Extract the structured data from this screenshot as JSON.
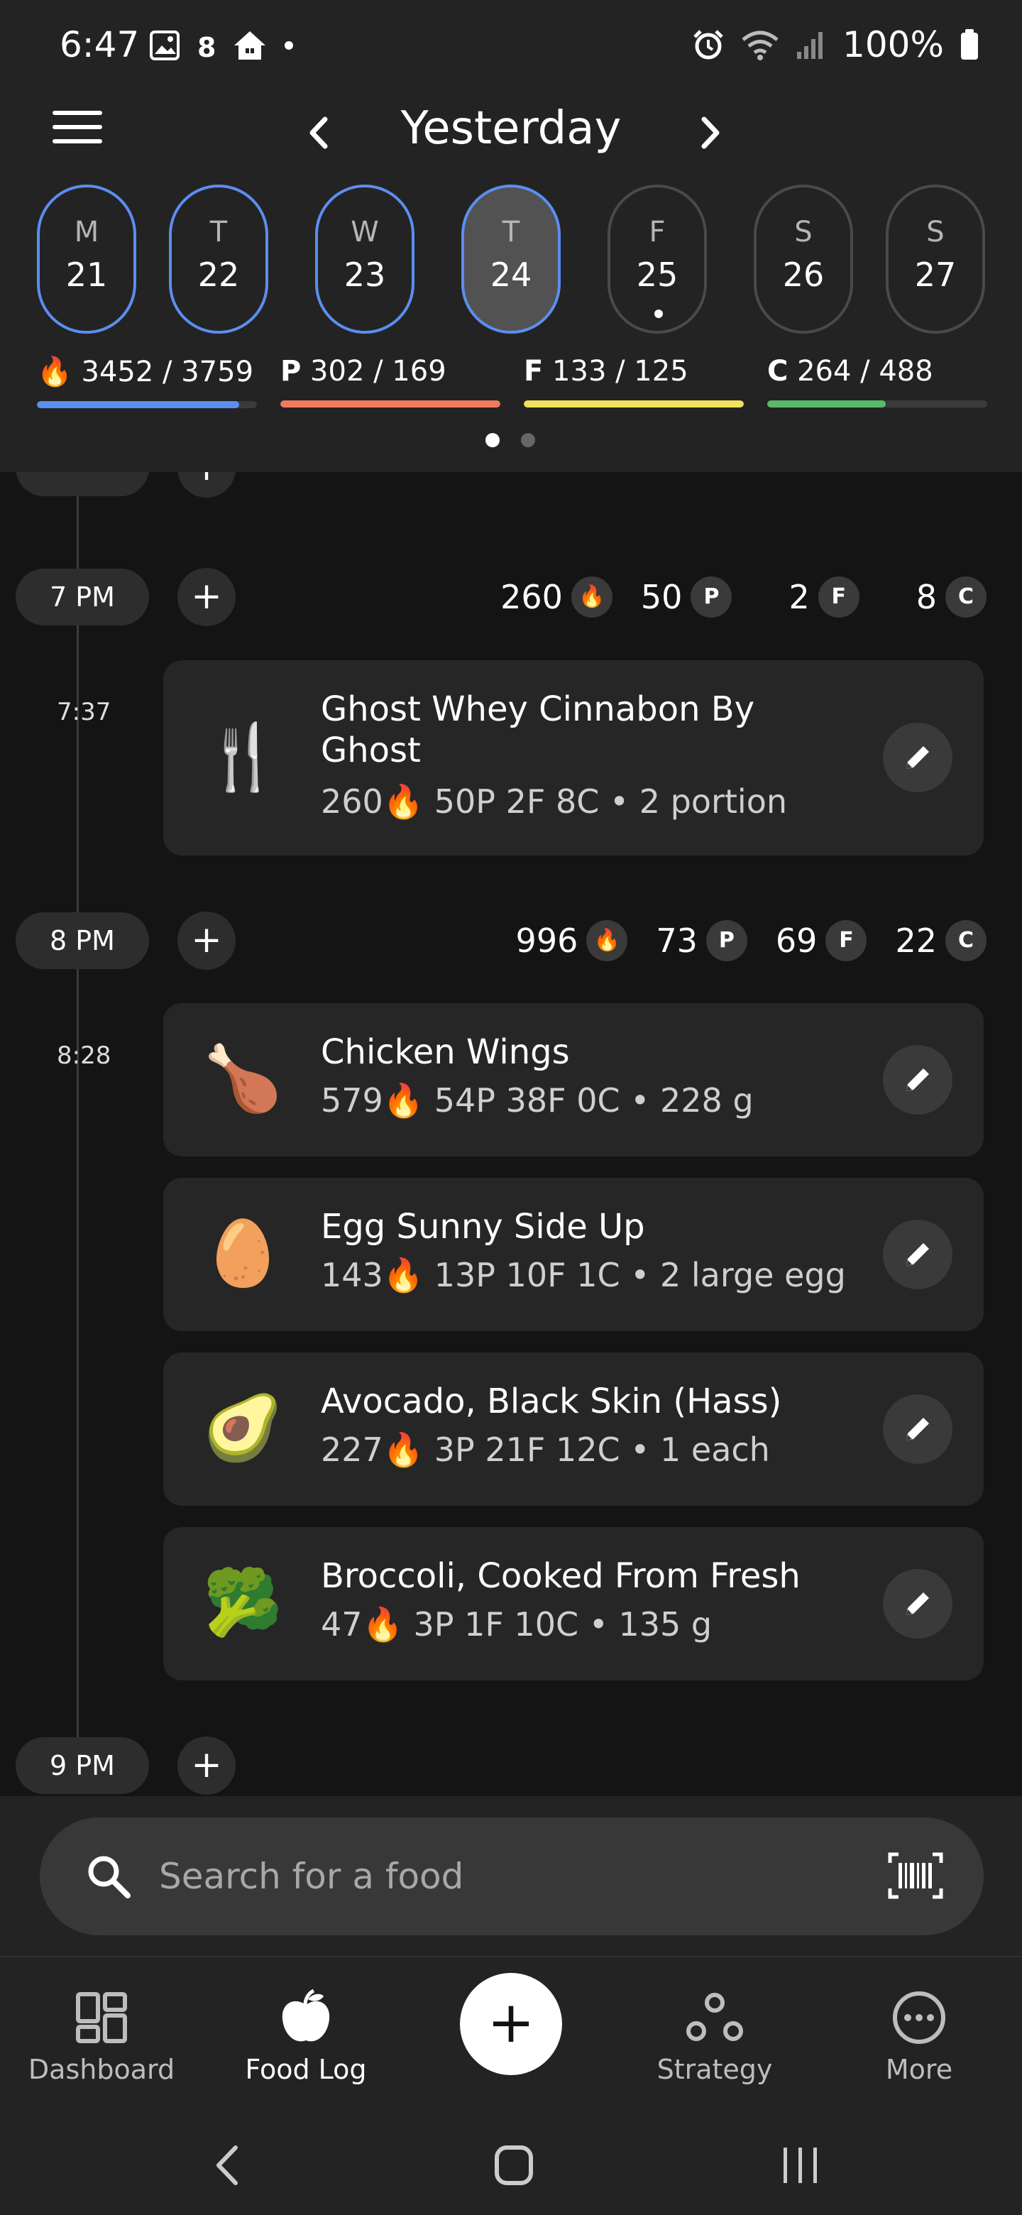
{
  "status_bar": {
    "time": "6:47",
    "battery": "100%",
    "icons_left": [
      "gallery-icon",
      "notification-8-icon",
      "home-icon",
      "dot-icon"
    ],
    "icons_right": [
      "alarm-icon",
      "wifi-icon",
      "signal-icon",
      "battery-icon"
    ]
  },
  "header": {
    "title": "Yesterday",
    "days": [
      {
        "letter": "M",
        "num": "21",
        "state": "logged"
      },
      {
        "letter": "T",
        "num": "22",
        "state": "logged"
      },
      {
        "letter": "W",
        "num": "23",
        "state": "logged"
      },
      {
        "letter": "T",
        "num": "24",
        "state": "selected"
      },
      {
        "letter": "F",
        "num": "25",
        "state": "today"
      },
      {
        "letter": "S",
        "num": "26",
        "state": "future"
      },
      {
        "letter": "S",
        "num": "27",
        "state": "future"
      }
    ],
    "macros": [
      {
        "key": "calories",
        "prefix": "🔥",
        "text": "3452 / 3759",
        "color": "#5b8ef0",
        "fraction": 0.92
      },
      {
        "key": "protein",
        "prefix": "P",
        "text": "302 / 169",
        "color": "#f07a5b",
        "fraction": 1.0
      },
      {
        "key": "fat",
        "prefix": "F",
        "text": "133 / 125",
        "color": "#f0e05b",
        "fraction": 1.0
      },
      {
        "key": "carbs",
        "prefix": "C",
        "text": "264 / 488",
        "color": "#5bb96b",
        "fraction": 0.54
      }
    ],
    "page_indicator": {
      "pages": 2,
      "current": 1
    }
  },
  "timeline": {
    "groups": [
      {
        "hour": "7 PM",
        "totals": {
          "cal": "260",
          "p": "50",
          "f": "2",
          "c": "8"
        },
        "time": "7:37",
        "entries": [
          {
            "name": "Ghost Whey Cinnabon By Ghost",
            "cal": "260",
            "macros": "50P  2F  8C",
            "amount": "2 portion",
            "icon": "🍴"
          }
        ]
      },
      {
        "hour": "8 PM",
        "totals": {
          "cal": "996",
          "p": "73",
          "f": "69",
          "c": "22"
        },
        "time": "8:28",
        "entries": [
          {
            "name": "Chicken Wings",
            "cal": "579",
            "macros": "54P  38F  0C",
            "amount": "228 g",
            "icon": "🍗"
          },
          {
            "name": "Egg Sunny Side Up",
            "cal": "143",
            "macros": "13P  10F  1C",
            "amount": "2 large egg",
            "icon": "🥚"
          },
          {
            "name": "Avocado, Black Skin (Hass)",
            "cal": "227",
            "macros": "3P  21F  12C",
            "amount": "1 each",
            "icon": "🥑"
          },
          {
            "name": "Broccoli, Cooked From Fresh",
            "cal": "47",
            "macros": "3P  1F  10C",
            "amount": "135 g",
            "icon": "🥦"
          }
        ]
      }
    ],
    "next_hour": "9 PM",
    "badges": {
      "p": "P",
      "f": "F",
      "c": "C"
    },
    "separator": "•"
  },
  "search": {
    "placeholder": "Search for a food"
  },
  "bottom_nav": {
    "items": [
      {
        "label": "Dashboard",
        "active": false
      },
      {
        "label": "Food Log",
        "active": true
      },
      {
        "label": "Strategy",
        "active": false
      },
      {
        "label": "More",
        "active": false
      }
    ],
    "fab": "+"
  },
  "add_symbol": "+"
}
